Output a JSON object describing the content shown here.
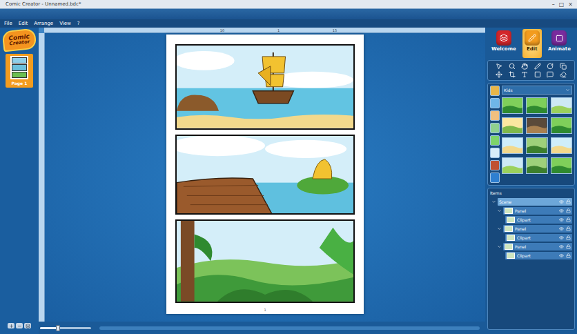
{
  "window": {
    "title": "Comic Creator - Unnamed.bdc*",
    "controls": [
      "–",
      "□",
      "×"
    ]
  },
  "menu": [
    "File",
    "Edit",
    "Arrange",
    "View",
    "?"
  ],
  "logo": [
    "Comic",
    "Creator"
  ],
  "pages": [
    {
      "label": "Page 1",
      "selected": true
    }
  ],
  "ruler": {
    "top": [
      "10",
      "1",
      "15"
    ]
  },
  "comic": {
    "panels": [
      {
        "kind": "ship"
      },
      {
        "kind": "island"
      },
      {
        "kind": "jungle"
      }
    ],
    "page_number": "1"
  },
  "zoom": {
    "level": 0.35
  },
  "tabs": [
    {
      "label": "Welcome",
      "selected": false,
      "color": "#d3262a"
    },
    {
      "label": "Edit",
      "selected": true,
      "color": "#f39c1e"
    },
    {
      "label": "Animate",
      "selected": false,
      "color": "#7a2c9e"
    }
  ],
  "library": {
    "category": "Kids",
    "thumbnails": [
      {
        "kind": "jungle"
      },
      {
        "kind": "jungle"
      },
      {
        "kind": "field"
      },
      {
        "kind": "meadow"
      },
      {
        "kind": "cave"
      },
      {
        "kind": "jungle"
      },
      {
        "kind": "beach"
      },
      {
        "kind": "forest"
      },
      {
        "kind": "beach"
      },
      {
        "kind": "field"
      },
      {
        "kind": "forest"
      },
      {
        "kind": "jungle"
      }
    ]
  },
  "items": {
    "title": "Items",
    "tree": [
      {
        "label": "Scene",
        "kind": "scene",
        "expanded": true
      },
      {
        "label": "Panel",
        "kind": "panel",
        "expanded": true
      },
      {
        "label": "Clipart",
        "kind": "clipart",
        "expanded": false
      },
      {
        "label": "Panel",
        "kind": "panel",
        "expanded": true
      },
      {
        "label": "Clipart",
        "kind": "clipart",
        "expanded": false
      },
      {
        "label": "Panel",
        "kind": "panel",
        "expanded": true
      },
      {
        "label": "Clipart",
        "kind": "clipart",
        "expanded": false
      }
    ]
  }
}
